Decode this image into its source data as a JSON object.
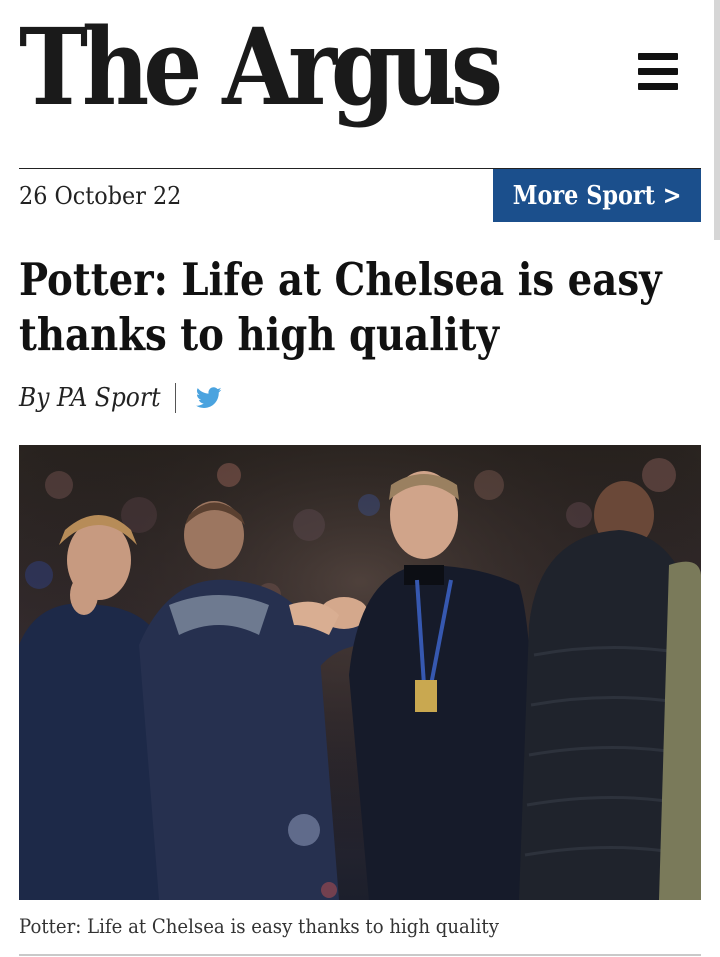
{
  "masthead": {
    "title": "The Argus",
    "brand_color": "#e3232b",
    "text_color": "#1a1a1a"
  },
  "menu": {
    "icon": "hamburger-menu-icon"
  },
  "article_meta": {
    "date": "26 October 22",
    "section_link": "More Sport >",
    "section_link_color": "#1b4f8c"
  },
  "article": {
    "headline": "Potter: Life at Chelsea is easy thanks to high quality",
    "byline": "By PA Sport",
    "share_icon": "twitter-icon",
    "share_icon_color": "#4aa3df",
    "image_alt": "photo-of-manager-shaking-hands-with-staff",
    "caption": "Potter: Life at Chelsea is easy thanks to high quality"
  }
}
